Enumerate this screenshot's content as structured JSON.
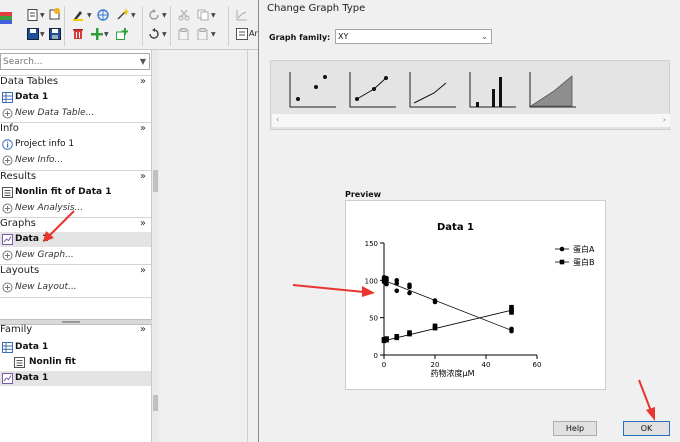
{
  "toolbar": {
    "label_an": "An"
  },
  "navigator": {
    "search_placeholder": "Search...",
    "sections": {
      "data_tables": "Data Tables",
      "info": "Info",
      "results": "Results",
      "graphs": "Graphs",
      "layouts": "Layouts",
      "family": "Family"
    },
    "chevron": "»",
    "items": {
      "data_table_1": "Data 1",
      "new_data_table": "New Data Table...",
      "project_info": "Project info 1",
      "new_info": "New Info...",
      "nonlin_fit": "Nonlin fit of Data 1",
      "new_analysis": "New Analysis...",
      "graph_data_1": "Data 1",
      "new_graph": "New Graph...",
      "new_layout": "New Layout..."
    },
    "family_items": {
      "data_1": "Data 1",
      "nonlin_fit": "Nonlin fit",
      "graph_data_1": "Data 1"
    }
  },
  "dialog": {
    "title": "Change Graph Type",
    "family_label": "Graph family:",
    "family_value": "XY",
    "preview_label": "Preview",
    "help_label": "Help",
    "ok_label": "OK"
  },
  "colors": {
    "accent_arrow": "#e8352d",
    "ok_border": "#2a6fbd",
    "selection": "#e4e4e4"
  },
  "chart_data": {
    "type": "scatter",
    "title": "Data 1",
    "xlabel": "药物浓度μM",
    "ylabel": "",
    "xlim": [
      0,
      60
    ],
    "ylim": [
      0,
      150
    ],
    "xticks": [
      "0",
      "20",
      "40",
      "60"
    ],
    "yticks": [
      "0",
      "50",
      "100",
      "150"
    ],
    "legend_position": "right",
    "series": [
      {
        "name": "蛋白A",
        "marker": "circle",
        "points": [
          [
            0,
            104
          ],
          [
            0,
            101
          ],
          [
            0,
            98
          ],
          [
            1,
            103
          ],
          [
            1,
            100
          ],
          [
            1,
            95
          ],
          [
            5,
            100
          ],
          [
            5,
            96
          ],
          [
            5,
            86
          ],
          [
            10,
            94
          ],
          [
            10,
            91
          ],
          [
            10,
            83
          ],
          [
            20,
            73
          ],
          [
            20,
            71
          ],
          [
            50,
            35
          ],
          [
            50,
            32
          ]
        ],
        "fit": [
          [
            0,
            100
          ],
          [
            50,
            33
          ]
        ]
      },
      {
        "name": "蛋白B",
        "marker": "square",
        "points": [
          [
            0,
            21
          ],
          [
            0,
            19
          ],
          [
            1,
            22
          ],
          [
            1,
            20
          ],
          [
            5,
            25
          ],
          [
            5,
            23
          ],
          [
            10,
            30
          ],
          [
            10,
            28
          ],
          [
            20,
            39
          ],
          [
            20,
            36
          ],
          [
            50,
            64
          ],
          [
            50,
            60
          ],
          [
            50,
            57
          ]
        ],
        "fit": [
          [
            0,
            19
          ],
          [
            50,
            60
          ]
        ]
      }
    ]
  }
}
